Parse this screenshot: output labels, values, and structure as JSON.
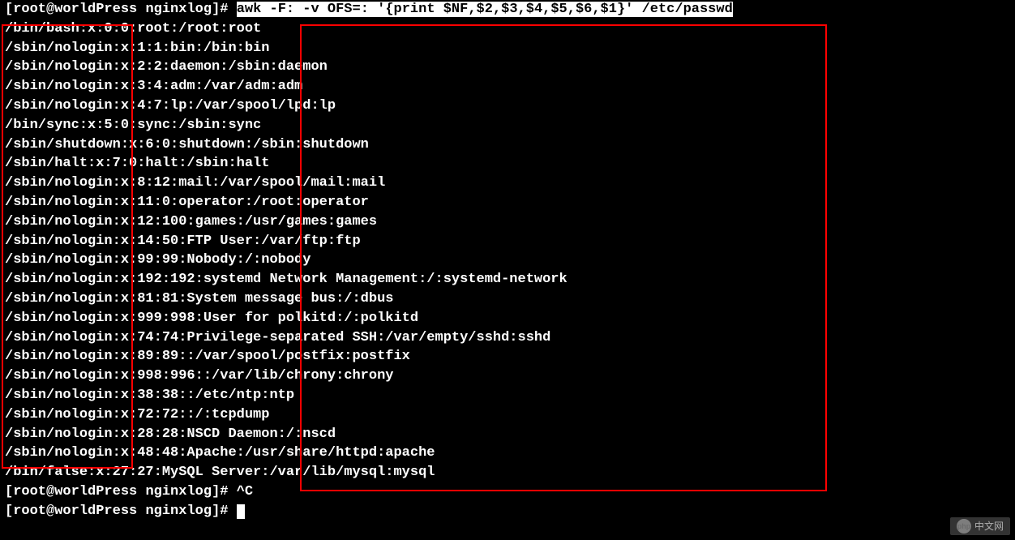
{
  "prompt_user": "root",
  "prompt_host": "worldPress",
  "prompt_dir": "nginxlog",
  "command": "awk -F: -v OFS=: '{print $NF,$2,$3,$4,$5,$6,$1}' /etc/passwd",
  "output_lines": [
    "/bin/bash:x:0:0:root:/root:root",
    "/sbin/nologin:x:1:1:bin:/bin:bin",
    "/sbin/nologin:x:2:2:daemon:/sbin:daemon",
    "/sbin/nologin:x:3:4:adm:/var/adm:adm",
    "/sbin/nologin:x:4:7:lp:/var/spool/lpd:lp",
    "/bin/sync:x:5:0:sync:/sbin:sync",
    "/sbin/shutdown:x:6:0:shutdown:/sbin:shutdown",
    "/sbin/halt:x:7:0:halt:/sbin:halt",
    "/sbin/nologin:x:8:12:mail:/var/spool/mail:mail",
    "/sbin/nologin:x:11:0:operator:/root:operator",
    "/sbin/nologin:x:12:100:games:/usr/games:games",
    "/sbin/nologin:x:14:50:FTP User:/var/ftp:ftp",
    "/sbin/nologin:x:99:99:Nobody:/:nobody",
    "/sbin/nologin:x:192:192:systemd Network Management:/:systemd-network",
    "/sbin/nologin:x:81:81:System message bus:/:dbus",
    "/sbin/nologin:x:999:998:User for polkitd:/:polkitd",
    "/sbin/nologin:x:74:74:Privilege-separated SSH:/var/empty/sshd:sshd",
    "/sbin/nologin:x:89:89::/var/spool/postfix:postfix",
    "/sbin/nologin:x:998:996::/var/lib/chrony:chrony",
    "/sbin/nologin:x:38:38::/etc/ntp:ntp",
    "/sbin/nologin:x:72:72::/:tcpdump",
    "/sbin/nologin:x:28:28:NSCD Daemon:/:nscd",
    "/sbin/nologin:x:48:48:Apache:/usr/share/httpd:apache",
    "/bin/false:x:27:27:MySQL Server:/var/lib/mysql:mysql"
  ],
  "prompt_2_suffix": "^C",
  "watermark_text": "中文网",
  "watermark_prefix": "php"
}
